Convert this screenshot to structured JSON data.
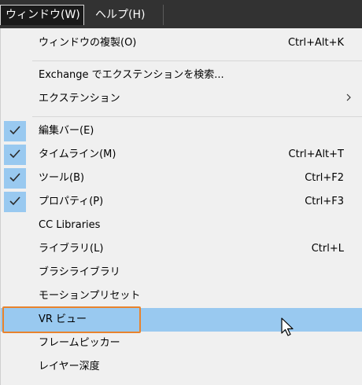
{
  "menubar": {
    "window_menu": "ウィンドウ(W)",
    "help_menu": "ヘルプ(H)"
  },
  "menu": {
    "items": [
      {
        "label": "ウィンドウの複製(O)",
        "shortcut": "Ctrl+Alt+K"
      },
      {
        "label": "Exchange でエクステンションを検索..."
      },
      {
        "label": "エクステンション"
      },
      {
        "label": "編集バー(E)",
        "checked": true
      },
      {
        "label": "タイムライン(M)",
        "shortcut": "Ctrl+Alt+T",
        "checked": true
      },
      {
        "label": "ツール(B)",
        "shortcut": "Ctrl+F2",
        "checked": true
      },
      {
        "label": "プロパティ(P)",
        "shortcut": "Ctrl+F3",
        "checked": true
      },
      {
        "label": "CC Libraries"
      },
      {
        "label": "ライブラリ(L)",
        "shortcut": "Ctrl+L"
      },
      {
        "label": "ブラシライブラリ"
      },
      {
        "label": "モーションプリセット"
      },
      {
        "label": "VR ビュー",
        "highlighted": true
      },
      {
        "label": "フレームピッカー"
      },
      {
        "label": "レイヤー深度"
      }
    ]
  },
  "colors": {
    "menubar_bg": "#323232",
    "highlight": "#99c9f0",
    "focus_ring": "#e8832d"
  }
}
